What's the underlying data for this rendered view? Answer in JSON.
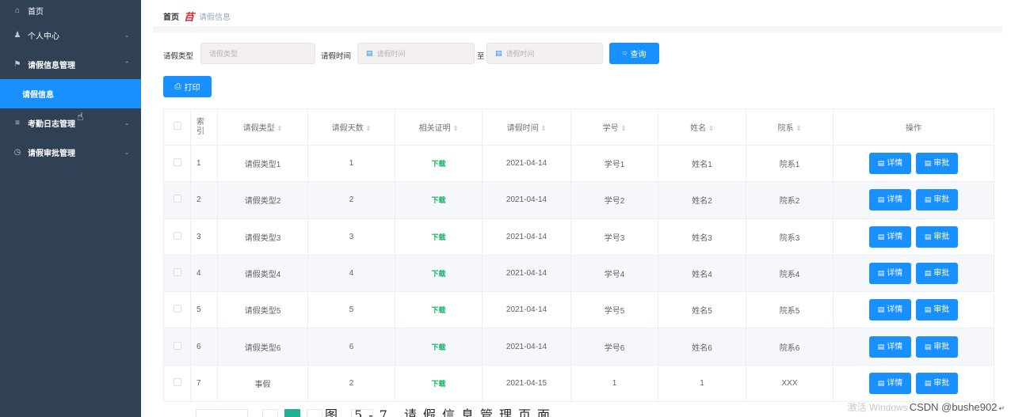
{
  "sidebar": {
    "items": [
      {
        "icon": "home-icon",
        "glyph": "⌂",
        "label": "首页",
        "chevron": false
      },
      {
        "icon": "user-icon",
        "glyph": "♟",
        "label": "个人中心",
        "chevron": true,
        "chev": "⌄"
      },
      {
        "icon": "flag-icon",
        "glyph": "⚑",
        "label": "请假信息管理",
        "chevron": true,
        "chev": "⌃"
      },
      {
        "icon": "",
        "glyph": "",
        "label": "请假信息",
        "chevron": false
      },
      {
        "icon": "list-icon",
        "glyph": "≡",
        "label": "考勤日志管理",
        "chevron": true,
        "chev": "⌄"
      },
      {
        "icon": "clock-icon",
        "glyph": "◷",
        "label": "请假审批管理",
        "chevron": true,
        "chev": "⌄"
      }
    ]
  },
  "breadcrumb": {
    "home": "首页",
    "separator": "䒤",
    "current": "请假信息"
  },
  "search": {
    "type_label": "请假类型",
    "type_placeholder": "请假类型",
    "time_label": "请假时间",
    "time_start_placeholder": "请假时间",
    "to_label": "至",
    "time_end_placeholder": "请假时间",
    "query_label": "查询",
    "print_label": "打印"
  },
  "table": {
    "headers": [
      "索引",
      "请假类型",
      "请假天数",
      "相关证明",
      "请假时间",
      "学号",
      "姓名",
      "院系",
      "操作"
    ],
    "detail_label": "详情",
    "approve_label": "审批",
    "rows": [
      {
        "index": "1",
        "type": "请假类型1",
        "days": "1",
        "proof": "下载",
        "time": "2021-04-14",
        "student_id": "学号1",
        "name": "姓名1",
        "dept": "院系1"
      },
      {
        "index": "2",
        "type": "请假类型2",
        "days": "2",
        "proof": "下载",
        "time": "2021-04-14",
        "student_id": "学号2",
        "name": "姓名2",
        "dept": "院系2"
      },
      {
        "index": "3",
        "type": "请假类型3",
        "days": "3",
        "proof": "下载",
        "time": "2021-04-14",
        "student_id": "学号3",
        "name": "姓名3",
        "dept": "院系3"
      },
      {
        "index": "4",
        "type": "请假类型4",
        "days": "4",
        "proof": "下载",
        "time": "2021-04-14",
        "student_id": "学号4",
        "name": "姓名4",
        "dept": "院系4"
      },
      {
        "index": "5",
        "type": "请假类型5",
        "days": "5",
        "proof": "下载",
        "time": "2021-04-14",
        "student_id": "学号5",
        "name": "姓名5",
        "dept": "院系5"
      },
      {
        "index": "6",
        "type": "请假类型6",
        "days": "6",
        "proof": "下载",
        "time": "2021-04-14",
        "student_id": "学号6",
        "name": "姓名6",
        "dept": "院系6"
      },
      {
        "index": "7",
        "type": "事假",
        "days": "2",
        "proof": "下载",
        "time": "2021-04-15",
        "student_id": "1",
        "name": "1",
        "dept": "XXX"
      }
    ]
  },
  "footer": {
    "caption": "图 5-7 请假信息管理页面",
    "watermark_activate": "激活 Windows",
    "watermark_csdn": "CSDN @bushe902"
  },
  "colors": {
    "sidebar_bg": "#304156",
    "accent": "#1890ff",
    "download": "#17b26a"
  }
}
